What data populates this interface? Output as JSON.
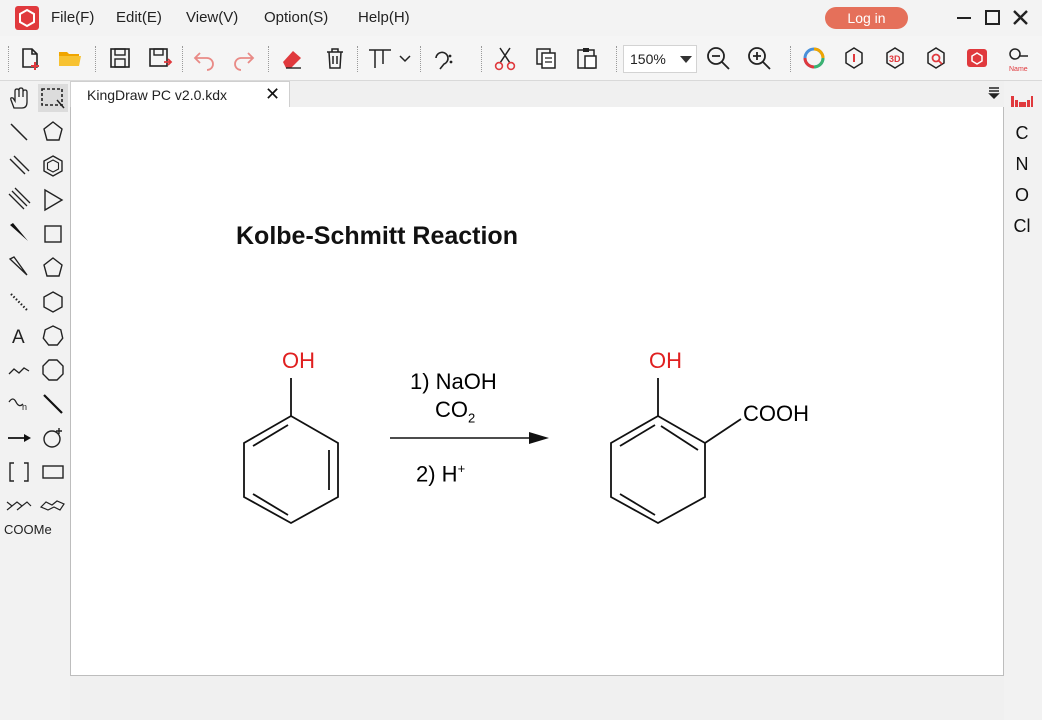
{
  "menu": [
    "File(F)",
    "Edit(E)",
    "View(V)",
    "Option(S)",
    "Help(H)"
  ],
  "login_label": "Log in",
  "zoom": {
    "value": "150%"
  },
  "tab": {
    "label": "KingDraw PC v2.0.kdx"
  },
  "left_panel": {
    "coome": "COOMe"
  },
  "right_panel": {
    "elements": [
      "C",
      "N",
      "O",
      "Cl"
    ]
  },
  "canvas": {
    "title": "Kolbe-Schmitt Reaction",
    "reactant_oh": "OH",
    "reagent1_prefix": "1) NaOH",
    "reagent_co": "CO",
    "reagent_co_sub": "2",
    "reagent2_prefix": "2) H",
    "reagent2_sup": "+",
    "product_oh": "OH",
    "product_cooh": "COOH"
  },
  "colors": {
    "brand": "#e0393d",
    "login": "#e5705a",
    "heteroatom": "#e02020"
  },
  "icons": {
    "toolbar": [
      "new-file-icon",
      "open-folder-icon",
      "save-icon",
      "save-as-icon",
      "undo-icon",
      "redo-icon",
      "eraser-icon",
      "delete-icon",
      "align-icon",
      "chirality-icon",
      "cut-icon",
      "copy-icon",
      "paste-icon",
      "zoom-out-icon",
      "zoom-in-icon",
      "ring-color-icon",
      "info-icon",
      "3d-icon",
      "search-structure-icon",
      "image-recognition-icon",
      "name-icon"
    ]
  }
}
